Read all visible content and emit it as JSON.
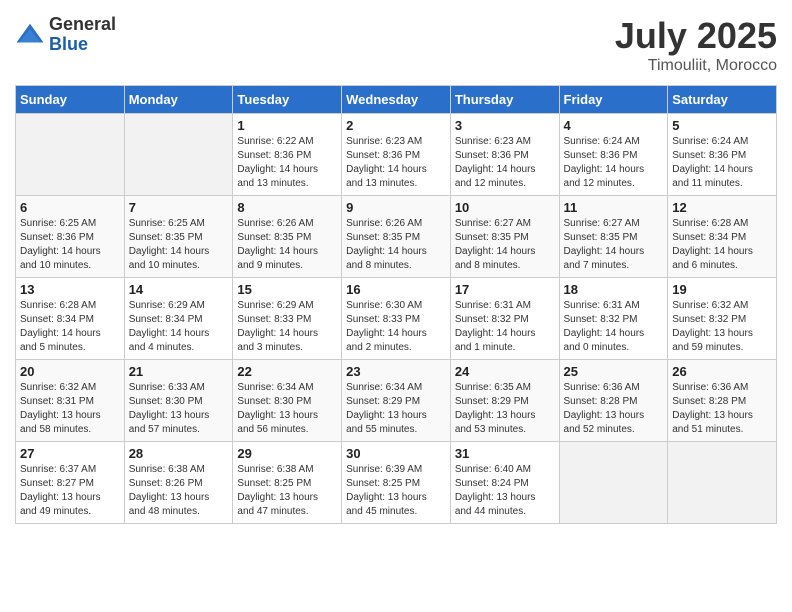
{
  "logo": {
    "general": "General",
    "blue": "Blue"
  },
  "title": {
    "month_year": "July 2025",
    "location": "Timouliit, Morocco"
  },
  "weekdays": [
    "Sunday",
    "Monday",
    "Tuesday",
    "Wednesday",
    "Thursday",
    "Friday",
    "Saturday"
  ],
  "weeks": [
    [
      {
        "day": "",
        "info": ""
      },
      {
        "day": "",
        "info": ""
      },
      {
        "day": "1",
        "info": "Sunrise: 6:22 AM\nSunset: 8:36 PM\nDaylight: 14 hours and 13 minutes."
      },
      {
        "day": "2",
        "info": "Sunrise: 6:23 AM\nSunset: 8:36 PM\nDaylight: 14 hours and 13 minutes."
      },
      {
        "day": "3",
        "info": "Sunrise: 6:23 AM\nSunset: 8:36 PM\nDaylight: 14 hours and 12 minutes."
      },
      {
        "day": "4",
        "info": "Sunrise: 6:24 AM\nSunset: 8:36 PM\nDaylight: 14 hours and 12 minutes."
      },
      {
        "day": "5",
        "info": "Sunrise: 6:24 AM\nSunset: 8:36 PM\nDaylight: 14 hours and 11 minutes."
      }
    ],
    [
      {
        "day": "6",
        "info": "Sunrise: 6:25 AM\nSunset: 8:36 PM\nDaylight: 14 hours and 10 minutes."
      },
      {
        "day": "7",
        "info": "Sunrise: 6:25 AM\nSunset: 8:35 PM\nDaylight: 14 hours and 10 minutes."
      },
      {
        "day": "8",
        "info": "Sunrise: 6:26 AM\nSunset: 8:35 PM\nDaylight: 14 hours and 9 minutes."
      },
      {
        "day": "9",
        "info": "Sunrise: 6:26 AM\nSunset: 8:35 PM\nDaylight: 14 hours and 8 minutes."
      },
      {
        "day": "10",
        "info": "Sunrise: 6:27 AM\nSunset: 8:35 PM\nDaylight: 14 hours and 8 minutes."
      },
      {
        "day": "11",
        "info": "Sunrise: 6:27 AM\nSunset: 8:35 PM\nDaylight: 14 hours and 7 minutes."
      },
      {
        "day": "12",
        "info": "Sunrise: 6:28 AM\nSunset: 8:34 PM\nDaylight: 14 hours and 6 minutes."
      }
    ],
    [
      {
        "day": "13",
        "info": "Sunrise: 6:28 AM\nSunset: 8:34 PM\nDaylight: 14 hours and 5 minutes."
      },
      {
        "day": "14",
        "info": "Sunrise: 6:29 AM\nSunset: 8:34 PM\nDaylight: 14 hours and 4 minutes."
      },
      {
        "day": "15",
        "info": "Sunrise: 6:29 AM\nSunset: 8:33 PM\nDaylight: 14 hours and 3 minutes."
      },
      {
        "day": "16",
        "info": "Sunrise: 6:30 AM\nSunset: 8:33 PM\nDaylight: 14 hours and 2 minutes."
      },
      {
        "day": "17",
        "info": "Sunrise: 6:31 AM\nSunset: 8:32 PM\nDaylight: 14 hours and 1 minute."
      },
      {
        "day": "18",
        "info": "Sunrise: 6:31 AM\nSunset: 8:32 PM\nDaylight: 14 hours and 0 minutes."
      },
      {
        "day": "19",
        "info": "Sunrise: 6:32 AM\nSunset: 8:32 PM\nDaylight: 13 hours and 59 minutes."
      }
    ],
    [
      {
        "day": "20",
        "info": "Sunrise: 6:32 AM\nSunset: 8:31 PM\nDaylight: 13 hours and 58 minutes."
      },
      {
        "day": "21",
        "info": "Sunrise: 6:33 AM\nSunset: 8:30 PM\nDaylight: 13 hours and 57 minutes."
      },
      {
        "day": "22",
        "info": "Sunrise: 6:34 AM\nSunset: 8:30 PM\nDaylight: 13 hours and 56 minutes."
      },
      {
        "day": "23",
        "info": "Sunrise: 6:34 AM\nSunset: 8:29 PM\nDaylight: 13 hours and 55 minutes."
      },
      {
        "day": "24",
        "info": "Sunrise: 6:35 AM\nSunset: 8:29 PM\nDaylight: 13 hours and 53 minutes."
      },
      {
        "day": "25",
        "info": "Sunrise: 6:36 AM\nSunset: 8:28 PM\nDaylight: 13 hours and 52 minutes."
      },
      {
        "day": "26",
        "info": "Sunrise: 6:36 AM\nSunset: 8:28 PM\nDaylight: 13 hours and 51 minutes."
      }
    ],
    [
      {
        "day": "27",
        "info": "Sunrise: 6:37 AM\nSunset: 8:27 PM\nDaylight: 13 hours and 49 minutes."
      },
      {
        "day": "28",
        "info": "Sunrise: 6:38 AM\nSunset: 8:26 PM\nDaylight: 13 hours and 48 minutes."
      },
      {
        "day": "29",
        "info": "Sunrise: 6:38 AM\nSunset: 8:25 PM\nDaylight: 13 hours and 47 minutes."
      },
      {
        "day": "30",
        "info": "Sunrise: 6:39 AM\nSunset: 8:25 PM\nDaylight: 13 hours and 45 minutes."
      },
      {
        "day": "31",
        "info": "Sunrise: 6:40 AM\nSunset: 8:24 PM\nDaylight: 13 hours and 44 minutes."
      },
      {
        "day": "",
        "info": ""
      },
      {
        "day": "",
        "info": ""
      }
    ]
  ]
}
